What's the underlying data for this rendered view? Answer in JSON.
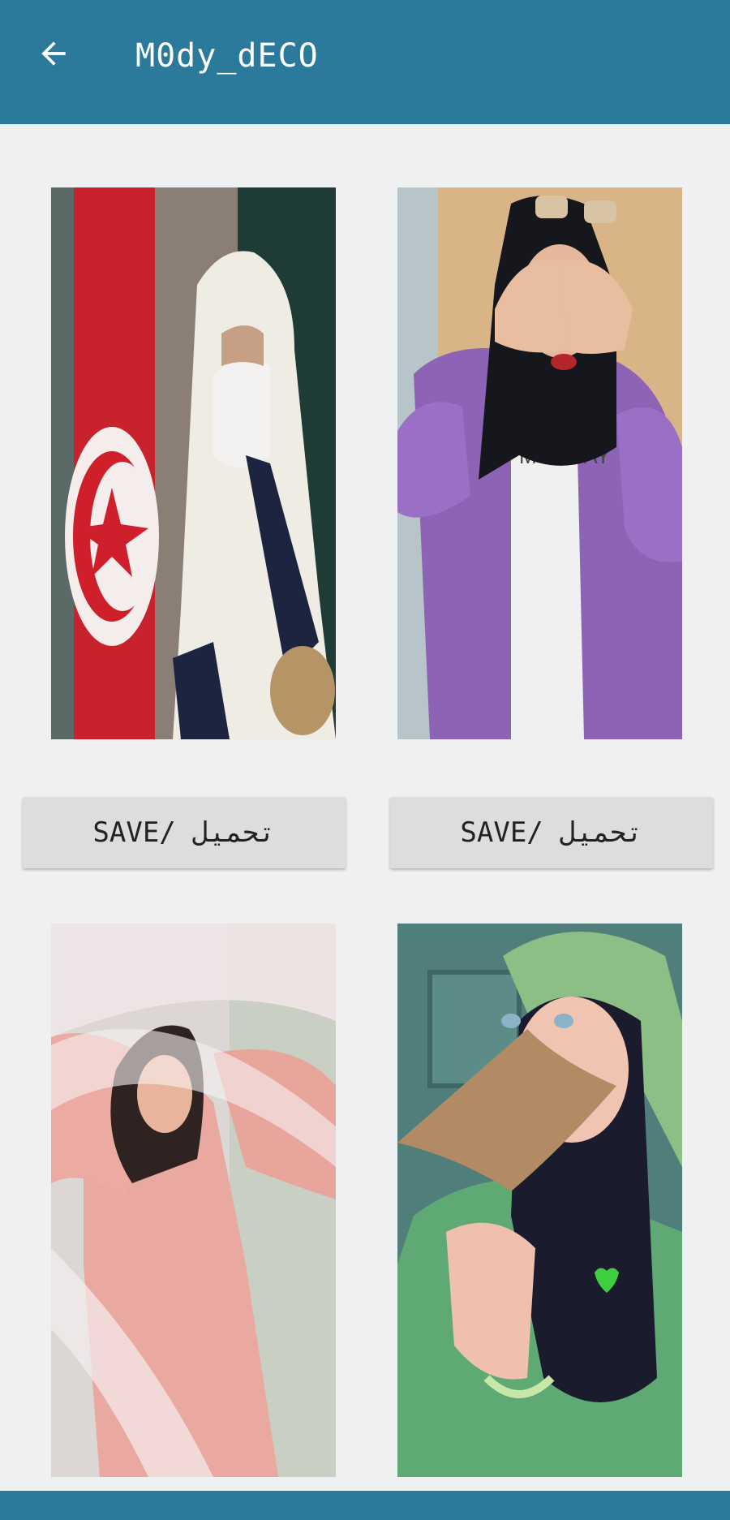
{
  "appbar": {
    "title": "M0dy_dECO",
    "back_icon": "arrow-left-icon",
    "color": "#2b7a9b"
  },
  "grid": {
    "items": [
      {
        "image": "photo-hijab-tunisia-flag",
        "save_label": "SAVE/ تحميل"
      },
      {
        "image": "photo-hijab-purple-coat",
        "save_label": "SAVE/ تحميل"
      },
      {
        "image": "photo-veil-floral-shirt"
      },
      {
        "image": "photo-green-scarf-leaf"
      }
    ]
  }
}
